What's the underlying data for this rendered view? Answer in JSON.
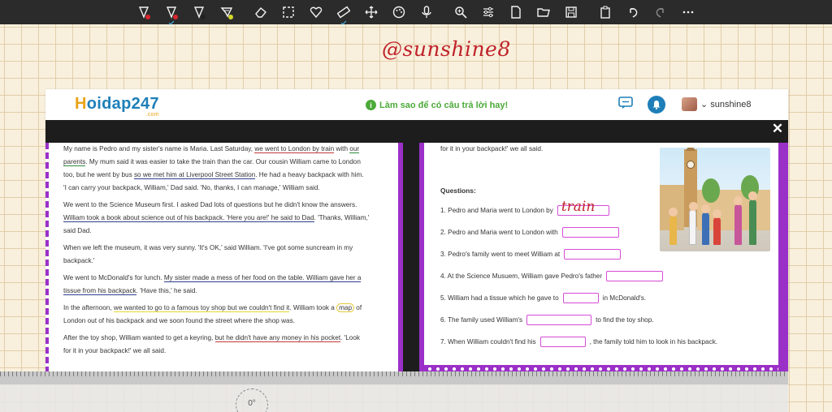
{
  "toolbar": {
    "tools": [
      {
        "name": "pen-red",
        "icon": "pen-icon",
        "dot": "#d8262d"
      },
      {
        "name": "pen-red-2",
        "icon": "pen-icon",
        "dot": "#d8262d",
        "selected": true
      },
      {
        "name": "pen-black",
        "icon": "pen-icon",
        "dot": "#222222"
      },
      {
        "name": "highlighter-yellow",
        "icon": "highlighter-icon",
        "dot": "#d6d82a"
      },
      {
        "name": "eraser",
        "icon": "eraser-icon"
      },
      {
        "name": "lasso",
        "icon": "lasso-select-icon"
      },
      {
        "name": "shapes",
        "icon": "heart-shape-icon"
      },
      {
        "name": "ruler-tool",
        "icon": "ruler-icon",
        "selected": true
      },
      {
        "name": "pan",
        "icon": "move-icon"
      },
      {
        "name": "colors",
        "icon": "palette-icon"
      },
      {
        "name": "voice",
        "icon": "microphone-icon"
      },
      {
        "name": "zoom",
        "icon": "zoom-icon"
      },
      {
        "name": "settings",
        "icon": "sliders-icon"
      },
      {
        "name": "new-page",
        "icon": "page-icon"
      },
      {
        "name": "open",
        "icon": "folder-icon"
      },
      {
        "name": "save",
        "icon": "save-icon"
      },
      {
        "name": "paste",
        "icon": "clipboard-icon"
      },
      {
        "name": "undo",
        "icon": "undo-icon"
      },
      {
        "name": "redo",
        "icon": "redo-icon"
      },
      {
        "name": "more",
        "icon": "more-icon"
      }
    ]
  },
  "handwriting": {
    "title": "@sunshine8",
    "answer_1": "train"
  },
  "site": {
    "logo_h": "H",
    "logo_rest": "oidap247",
    "logo_com": ".com",
    "hint": "Làm sao để có câu trả lời hay!",
    "username": "sunshine8",
    "close": "✕"
  },
  "story": {
    "p1": [
      {
        "t": "My name is Pedro and my sister's name is Maria. Last Saturday, "
      },
      {
        "t": "we went to London by train",
        "u": "red"
      },
      {
        "t": " with "
      },
      {
        "t": "our",
        "u": "green"
      }
    ],
    "p1_l2": [
      {
        "t": "parents",
        "u": "green"
      },
      {
        "t": ". My mum said it was easier to take the train than the car. Our cousin William came to London"
      }
    ],
    "p1_l3": [
      {
        "t": "too, but he went by bus "
      },
      {
        "t": "so we met him at Liverpool Street Station",
        "u": "blue"
      },
      {
        "t": ". He had a heavy backpack with him."
      }
    ],
    "p1_l4": "'I can carry your backpack, William,' Dad said. 'No, thanks, I can manage,' William said.",
    "p2_l1": "We went to the Science Museum first. I asked Dad lots of questions but he didn't know the answers.",
    "p2_l2": [
      {
        "t": "William took a book about science out of his backpack. 'Here you are!' he said to Dad",
        "u": "blue"
      },
      {
        "t": ". 'Thanks, William,'"
      }
    ],
    "p2_l3": "said Dad.",
    "p3_l1": "When we left the museum, it was very sunny. 'It's OK,' said William. 'I've got some suncream in my",
    "p3_l2": "backpack.'",
    "p4_l1": [
      {
        "t": "We went to McDonald's for lunch. "
      },
      {
        "t": "My sister made a mess of her food on the table. William gave her a",
        "u": "blue"
      }
    ],
    "p4_l2": [
      {
        "t": "tissue from his backpack",
        "u": "blue"
      },
      {
        "t": ". 'Have this,' he said."
      }
    ],
    "p5_l1": [
      {
        "t": "In the afternoon, "
      },
      {
        "t": "we wanted to go to a famous toy shop but we couldn't find it",
        "u": "yellow"
      },
      {
        "t": ". William took a "
      },
      {
        "t": "map",
        "c": true
      },
      {
        "t": " of"
      }
    ],
    "p5_l2": "London out of his backpack and we soon found the street where the shop was.",
    "p6_l1": [
      {
        "t": "After the toy shop, William wanted to get a keyring, "
      },
      {
        "t": "but he didn't have any money in his pocket",
        "u": "red"
      },
      {
        "t": ". 'Look"
      }
    ],
    "p6_l2": "for it in your backpack!' we all said."
  },
  "right_page": {
    "top_line": "for it in your backpack!' we all said.",
    "questions_title": "Questions:",
    "questions": [
      {
        "before": "1. Pedro and Maria went to London by",
        "after": ""
      },
      {
        "before": "2. Pedro and Maria went to London with",
        "after": ""
      },
      {
        "before": "3. Pedro's family went to meet William at",
        "after": ""
      },
      {
        "before": "4. At the Science Musuem, William gave Pedro's father",
        "after": ""
      },
      {
        "before": "5. William had a tissue which he gave to",
        "after": "in McDonald's."
      },
      {
        "before": "6. The family used William's",
        "after": "to find the toy shop."
      },
      {
        "before": "7. When William couldn't find his",
        "after": ", the family told him to look in his backpack."
      }
    ]
  },
  "ruler": {
    "angle": "0°"
  },
  "colors": {
    "purple": "#9b30c8",
    "handwriting": "#c0222a",
    "blank_border": "#d64bd8"
  }
}
